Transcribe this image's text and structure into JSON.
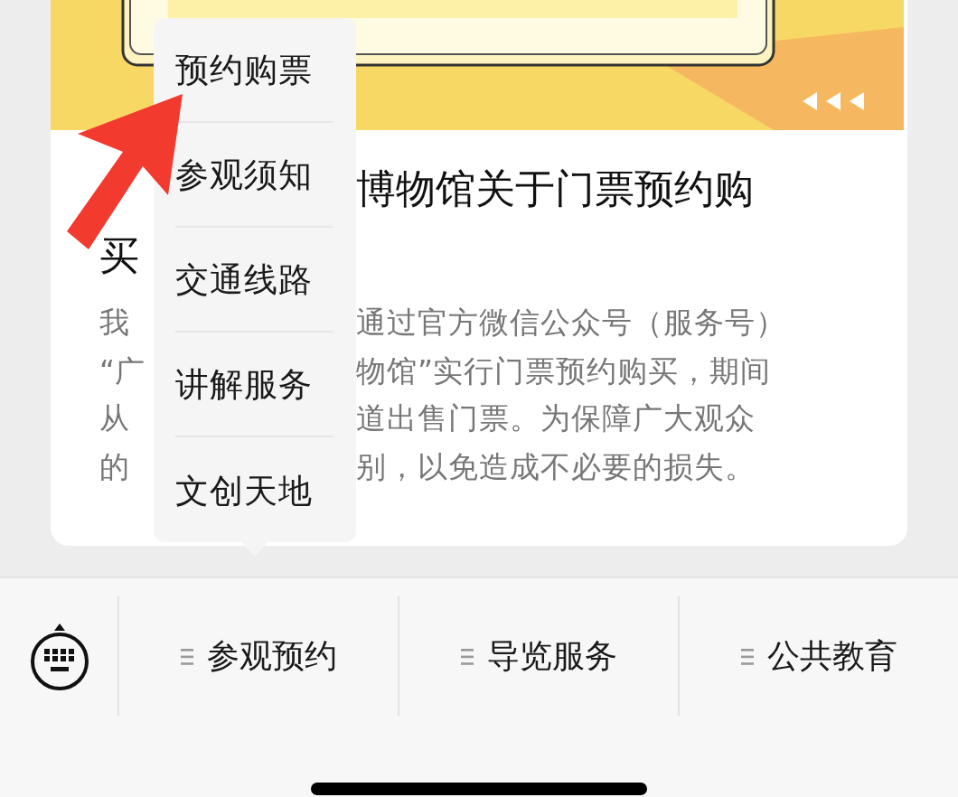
{
  "article": {
    "title_lines": [
      {
        "right": "博物馆关于门票预约购"
      },
      {
        "left": "买"
      }
    ],
    "body_lines": [
      {
        "left": "我",
        "right": "通过官方微信公众号（服务号）"
      },
      {
        "left": "“广",
        "right": "物馆”实行门票预约购买，期间"
      },
      {
        "left": "从",
        "right": "道出售门票。为保障广大观众"
      },
      {
        "left": "的",
        "right": "别，以免造成不必要的损失。"
      }
    ]
  },
  "popup_menu": {
    "items": [
      "预约购票",
      "参观须知",
      "交通线路",
      "讲解服务",
      "文创天地"
    ]
  },
  "bottom_menu": {
    "items": [
      "参观预约",
      "导览服务",
      "公共教育"
    ]
  }
}
